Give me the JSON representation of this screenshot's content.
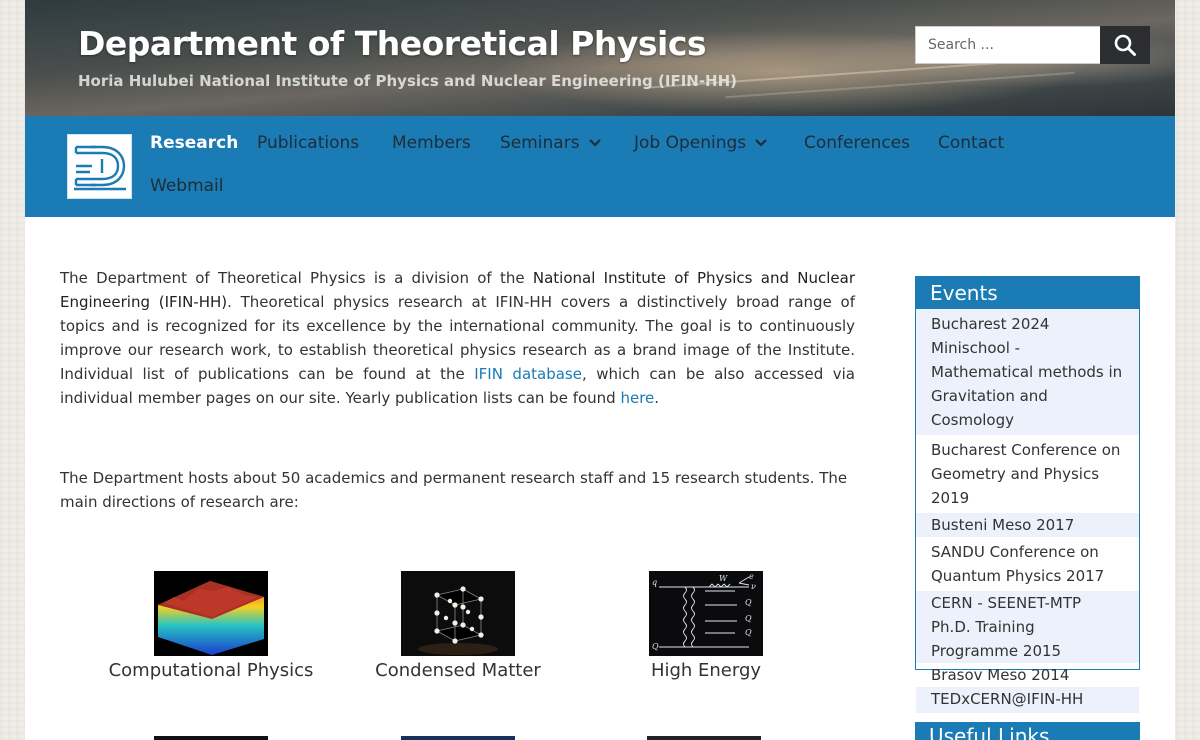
{
  "header": {
    "title": "Department of Theoretical Physics",
    "subtitle": "Horia Hulubei National Institute of Physics and Nuclear Engineering (IFIN-HH)",
    "search_placeholder": "Search ..."
  },
  "nav": {
    "items": [
      {
        "label": "Research",
        "active": true
      },
      {
        "label": "Publications"
      },
      {
        "label": "Members"
      },
      {
        "label": "Seminars",
        "dropdown": true
      },
      {
        "label": "Job Openings",
        "dropdown": true
      },
      {
        "label": "Conferences"
      },
      {
        "label": "Contact"
      },
      {
        "label": "Webmail"
      }
    ]
  },
  "content": {
    "p1_a": "The Department of Theoretical Physics is a division of the ",
    "p1_link1": "National Institute of Physics and Nuclear Engineering (IFIN-HH)",
    "p1_b": ". Theoretical physics research at IFIN-HH covers a distinctively broad range of topics and is recognized for its excellence by the international community. The goal is to continuously improve our research work, to establish theoretical physics research as a brand image of the Institute. Individual list of publications can be found at the ",
    "p1_link2": "IFIN database",
    "p1_c": ", which can be also accessed via individual member pages on our site. Yearly publication lists can be found ",
    "p1_link3": "here",
    "p1_d": ".",
    "p2": "The Department hosts about 50 academics and permanent research staff and 15 research students. The main directions of research are:",
    "research": [
      {
        "label": "Computational Physics"
      },
      {
        "label": "Condensed Matter"
      },
      {
        "label": "High Energy"
      }
    ]
  },
  "sidebar": {
    "events_title": "Events",
    "events": [
      "Bucharest 2024 Minischool - Mathematical methods in Gravitation and Cosmology",
      "Bucharest Conference on Geometry and Physics 2019",
      "Busteni Meso 2017",
      "SANDU Conference on Quantum Physics 2017",
      "CERN - SEENET-MTP Ph.D. Training Programme 2015",
      "Brasov Meso 2014",
      "TEDxCERN@IFIN-HH"
    ],
    "links_title": "Useful Links"
  },
  "colors": {
    "accent": "#1a7bb5",
    "event_alt_bg": "#ecf1fb",
    "search_button": "#2b2d30"
  }
}
